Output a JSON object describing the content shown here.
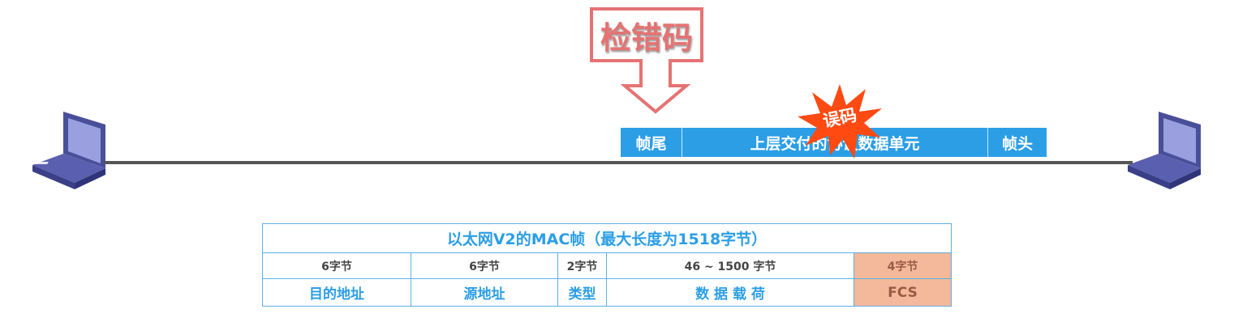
{
  "callout": {
    "label": "检错码",
    "color": "#e57373"
  },
  "burst": {
    "label": "误码",
    "color": "#ff4a12"
  },
  "frame": {
    "trailer": "帧尾",
    "payload": "上层交付的协议数据单元",
    "header": "帧头",
    "color": "#2b9ee6"
  },
  "table": {
    "title": "以太网V2的MAC帧（最大长度为1518字节）",
    "sizes": [
      "6字节",
      "6字节",
      "2字节",
      "46 ~ 1500 字节",
      "4字节"
    ],
    "fields": [
      "目的地址",
      "源地址",
      "类型",
      "数 据 载 荷",
      "FCS"
    ]
  }
}
